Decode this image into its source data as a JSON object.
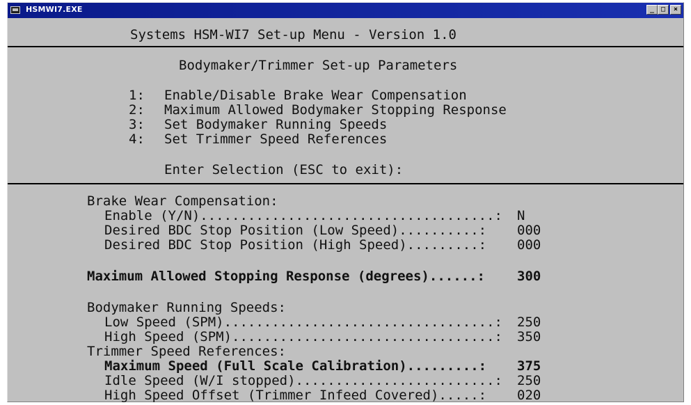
{
  "window": {
    "title": "HSMWI7.EXE",
    "controls": {
      "minimize": "_",
      "maximize": "□",
      "close": "×"
    }
  },
  "header": {
    "title": "Systems HSM-WI7 Set-up Menu - Version 1.0"
  },
  "menu": {
    "heading": "Bodymaker/Trimmer Set-up Parameters",
    "items": [
      {
        "key": "1:",
        "label": "Enable/Disable Brake Wear Compensation"
      },
      {
        "key": "2:",
        "label": "Maximum Allowed Bodymaker Stopping Response"
      },
      {
        "key": "3:",
        "label": "Set Bodymaker Running Speeds"
      },
      {
        "key": "4:",
        "label": "Set Trimmer Speed References"
      }
    ],
    "prompt": "Enter Selection (ESC to exit):"
  },
  "status": {
    "brake": {
      "heading": "Brake Wear Compensation:",
      "rows": [
        {
          "label": "Enable (Y/N).....................................:",
          "value": "N"
        },
        {
          "label": "Desired BDC Stop Position (Low Speed)..........:",
          "value": "000"
        },
        {
          "label": "Desired BDC Stop Position (High Speed).........:",
          "value": "000"
        }
      ]
    },
    "stopping": {
      "label": "Maximum Allowed Stopping Response (degrees)......:",
      "value": "300"
    },
    "bodymaker": {
      "heading": "Bodymaker Running Speeds:",
      "rows": [
        {
          "label": "Low Speed (SPM)..................................:",
          "value": "250"
        },
        {
          "label": "High Speed (SPM).................................:",
          "value": "350"
        }
      ]
    },
    "trimmer": {
      "heading": "Trimmer Speed References:",
      "rows": [
        {
          "label": "Maximum Speed (Full Scale Calibration).........:",
          "value": "375"
        },
        {
          "label": "Idle Speed (W/I stopped).........................:",
          "value": "250"
        },
        {
          "label": "High Speed Offset (Trimmer Infeed Covered).....:",
          "value": "020"
        }
      ]
    }
  }
}
